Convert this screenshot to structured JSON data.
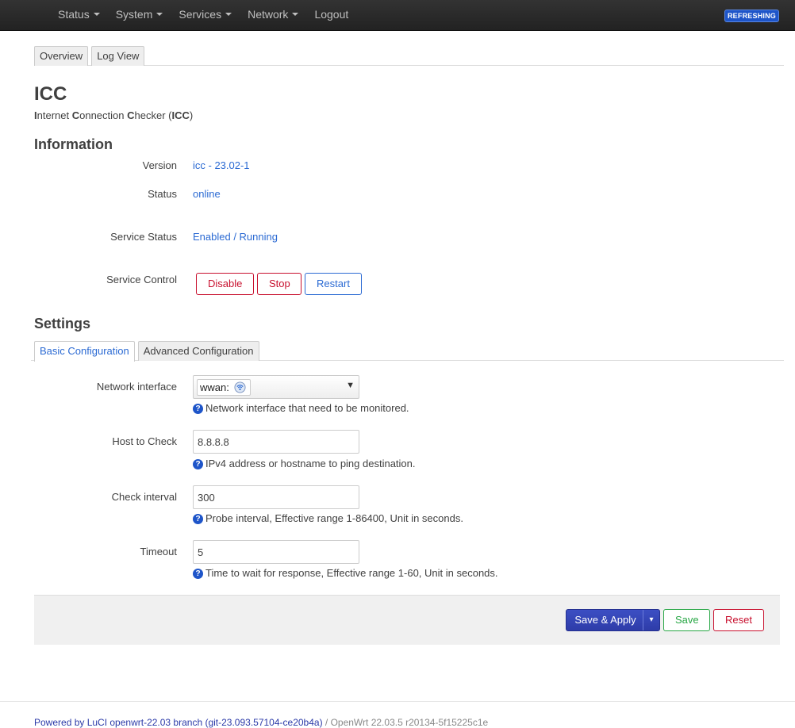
{
  "nav": {
    "items": [
      {
        "label": "Status",
        "dropdown": true
      },
      {
        "label": "System",
        "dropdown": true
      },
      {
        "label": "Services",
        "dropdown": true
      },
      {
        "label": "Network",
        "dropdown": true
      },
      {
        "label": "Logout",
        "dropdown": false
      }
    ],
    "badge": "REFRESHING"
  },
  "tabs": [
    "Overview",
    "Log View"
  ],
  "page": {
    "title": "ICC",
    "subtitle_parts": [
      {
        "bold": "I",
        "rest": "nternet "
      },
      {
        "bold": "C",
        "rest": "onnection "
      },
      {
        "bold": "C",
        "rest": "hecker ("
      },
      {
        "bold": "ICC",
        "rest": ")"
      }
    ]
  },
  "information": {
    "title": "Information",
    "version_label": "Version",
    "version_value": "icc - 23.02-1",
    "status_label": "Status",
    "status_value": "online",
    "service_status_label": "Service Status",
    "service_status_value": "Enabled / Running",
    "service_control_label": "Service Control",
    "buttons": {
      "disable": "Disable",
      "stop": "Stop",
      "restart": "Restart"
    }
  },
  "settings": {
    "title": "Settings",
    "tabs": [
      "Basic Configuration",
      "Advanced Configuration"
    ],
    "fields": {
      "network_interface": {
        "label": "Network interface",
        "value": "wwan:",
        "help": "Network interface that need to be monitored."
      },
      "host": {
        "label": "Host to Check",
        "value": "8.8.8.8",
        "help": "IPv4 address or hostname to ping destination."
      },
      "interval": {
        "label": "Check interval",
        "value": "300",
        "help": "Probe interval, Effective range 1-86400, Unit in seconds."
      },
      "timeout": {
        "label": "Timeout",
        "value": "5",
        "help": "Time to wait for response, Effective range 1-60, Unit in seconds."
      }
    }
  },
  "actions": {
    "save_apply": "Save & Apply",
    "dropdown_arrow": "▾",
    "save": "Save",
    "reset": "Reset"
  },
  "footer": {
    "link": "Powered by LuCI openwrt-22.03 branch (git-23.093.57104-ce20b4a)",
    "rest": " / OpenWrt 22.03.5 r20134-5f15225c1e"
  },
  "colors": {
    "accent": "#2b6ad3",
    "danger": "#c8102e",
    "success": "#28a745",
    "primary": "#2e3ca8"
  }
}
